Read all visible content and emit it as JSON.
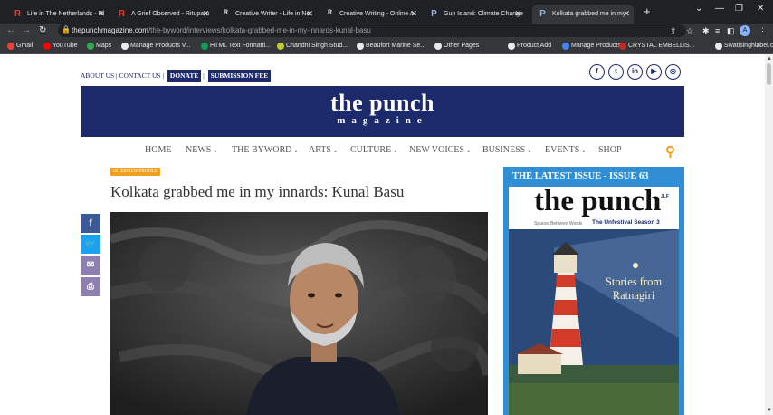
{
  "browser": {
    "tabs": [
      {
        "title": "Life in The Netherlands - Ri",
        "favicon": "R",
        "favicon_color": "#e53935"
      },
      {
        "title": "A Grief Observed - Rituparn",
        "favicon": "R",
        "favicon_color": "#e53935"
      },
      {
        "title": "Creative Writer - Life in Ne",
        "favicon": "ᴿ",
        "favicon_color": "#e8eaed"
      },
      {
        "title": "Creative Writing - Online A",
        "favicon": "ᴿ",
        "favicon_color": "#e8eaed"
      },
      {
        "title": "Gun Island: Climate Change",
        "favicon": "P",
        "favicon_color": "#8ab4f8"
      },
      {
        "title": "Kolkata grabbed me in my",
        "favicon": "P",
        "favicon_color": "#8ab4f8",
        "active": true
      }
    ],
    "new_tab": "+",
    "url_host": "thepunchmagazine.com",
    "url_path": "/the-byword/interviews/kolkata-grabbed-me-in-my-innards-kunal-basu",
    "profile_initial": "A",
    "bookmarks": [
      {
        "label": "Gmail",
        "color": "#ea4335"
      },
      {
        "label": "YouTube",
        "color": "#ff0000"
      },
      {
        "label": "Maps",
        "color": "#34a853"
      },
      {
        "label": "Manage Products V...",
        "color": "#e8eaed"
      },
      {
        "label": "HTML Text Formatti...",
        "color": "#0f9d58"
      },
      {
        "label": "Chandni Singh Stud...",
        "color": "#c0ca33"
      },
      {
        "label": "Beaufort Marine Se...",
        "color": "#e8eaed"
      },
      {
        "label": "Other Pages",
        "color": "#e8eaed"
      },
      {
        "label": "Product Add",
        "color": "#e8eaed"
      },
      {
        "label": "Manage Products",
        "color": "#4285f4"
      },
      {
        "label": "CRYSTAL EMBELLIS...",
        "color": "#c62828"
      },
      {
        "label": "Swatisinghlabel.com",
        "color": "#e8eaed"
      }
    ],
    "bookmarks_more": "»"
  },
  "site": {
    "toplinks": {
      "about": "ABOUT US",
      "contact": "CONTACT US",
      "donate": "DONATE",
      "submission": "SUBMISSION FEE"
    },
    "social_icons": [
      "facebook-icon",
      "twitter-icon",
      "linkedin-icon",
      "youtube-icon",
      "instagram-icon"
    ],
    "social_glyphs": [
      "f",
      "t",
      "in",
      "▶",
      "◎"
    ],
    "banner_title": "the punch",
    "banner_subtitle": "magazine",
    "nav": [
      {
        "label": "HOME",
        "dropdown": false
      },
      {
        "label": "NEWS",
        "dropdown": true
      },
      {
        "label": "THE BYWORD",
        "dropdown": true
      },
      {
        "label": "ARTS",
        "dropdown": true
      },
      {
        "label": "CULTURE",
        "dropdown": true
      },
      {
        "label": "NEW VOICES",
        "dropdown": true
      },
      {
        "label": "BUSINESS",
        "dropdown": true
      },
      {
        "label": "EVENTS",
        "dropdown": true
      },
      {
        "label": "SHOP",
        "dropdown": false
      }
    ],
    "brand_color": "#1c2a6b",
    "accent_color": "#f0a020"
  },
  "article": {
    "category": "INTERVIEW/PROFILE",
    "headline": "Kolkata grabbed me in my innards: Kunal Basu",
    "share": [
      {
        "name": "facebook-share-icon",
        "glyph": "f",
        "color": "#3b5998"
      },
      {
        "name": "twitter-share-icon",
        "glyph": "🐦",
        "color": "#1da1f2"
      },
      {
        "name": "email-share-icon",
        "glyph": "✉",
        "color": "#8e7fb3"
      },
      {
        "name": "print-share-icon",
        "glyph": "⎙",
        "color": "#8e7fb3"
      }
    ]
  },
  "sidebar": {
    "title": "THE LATEST ISSUE - ISSUE 63",
    "cover_title": "the punch",
    "cover_tagline": "Spaces Between Words",
    "cover_season": "The Unfestival Season 3",
    "cover_stories_line1": "Stories from",
    "cover_stories_line2": "Ratnagiri"
  }
}
